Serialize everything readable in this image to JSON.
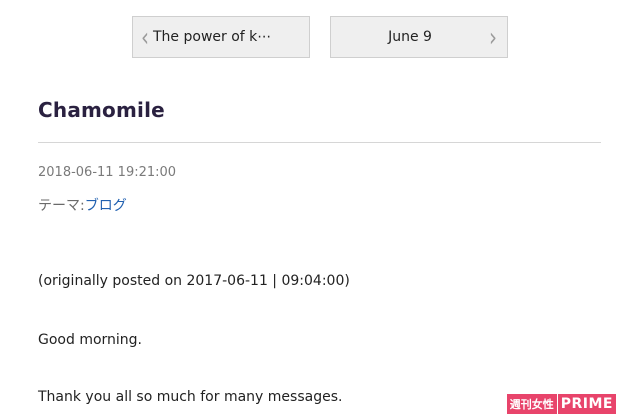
{
  "nav": {
    "prev_label": "The power of k⋯",
    "next_label": "June 9",
    "prev_icon": "chevron-left-icon",
    "next_icon": "chevron-right-icon"
  },
  "post": {
    "title": "Chamomile",
    "datetime": "2018-06-11 19:21:00",
    "theme_prefix": "テーマ:",
    "theme_link": "ブログ",
    "paragraphs": [
      "(originally posted on 2017-06-11 | 09:04:00)",
      "Good morning.",
      "Thank you all so much for many messages."
    ]
  },
  "watermark": {
    "jp": "週刊女性",
    "brand": "PRIME"
  },
  "colors": {
    "link": "#2060b0",
    "title": "#2a2140",
    "watermark": "#e8446b"
  }
}
